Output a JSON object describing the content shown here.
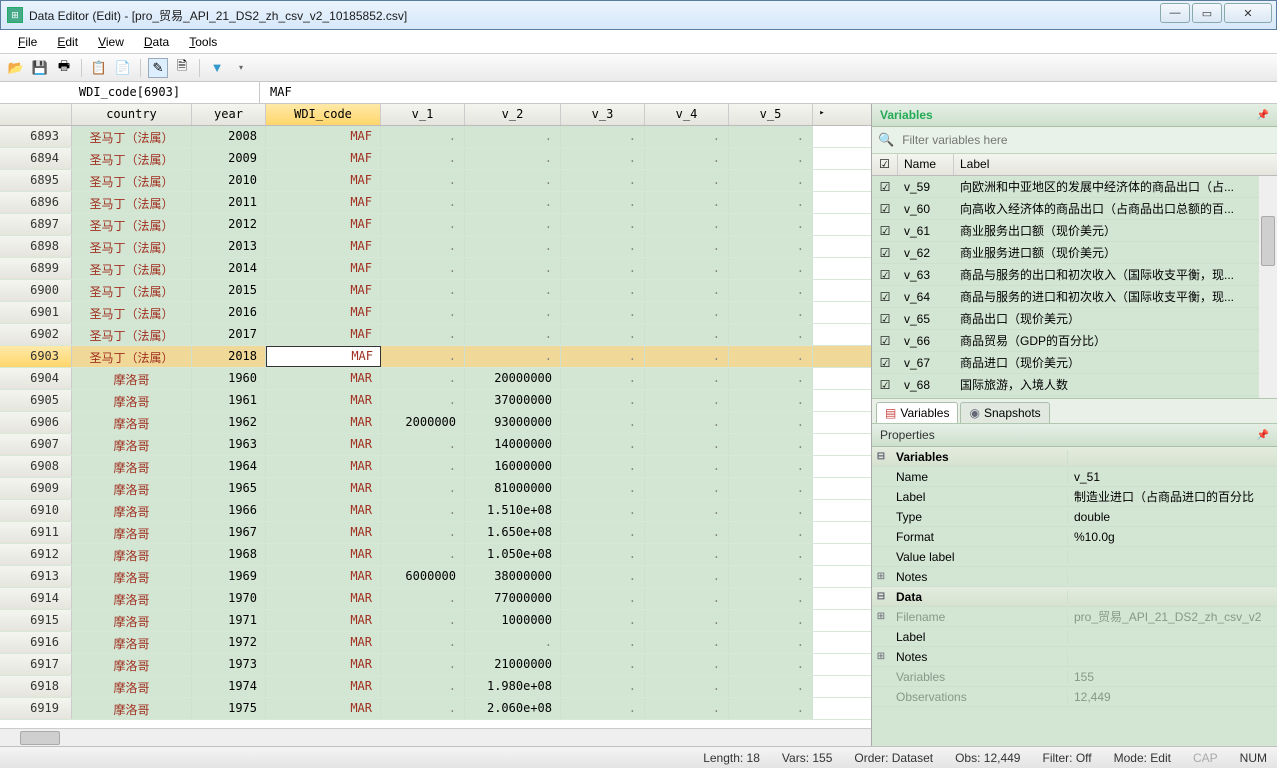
{
  "window": {
    "title": "Data Editor (Edit) - [pro_贸易_API_21_DS2_zh_csv_v2_10185852.csv]"
  },
  "menu": {
    "file": "File",
    "edit": "Edit",
    "view": "View",
    "data": "Data",
    "tools": "Tools"
  },
  "refbar": {
    "cell": "WDI_code[6903]",
    "value": "MAF"
  },
  "columns": [
    "country",
    "year",
    "WDI_code",
    "v_1",
    "v_2",
    "v_3",
    "v_4",
    "v_5"
  ],
  "selected_row": 6903,
  "rows": [
    {
      "n": 6893,
      "country": "圣马丁（法属）",
      "year": 2008,
      "code": "MAF",
      "v1": ".",
      "v2": ".",
      "v3": ".",
      "v4": ".",
      "v5": "."
    },
    {
      "n": 6894,
      "country": "圣马丁（法属）",
      "year": 2009,
      "code": "MAF",
      "v1": ".",
      "v2": ".",
      "v3": ".",
      "v4": ".",
      "v5": "."
    },
    {
      "n": 6895,
      "country": "圣马丁（法属）",
      "year": 2010,
      "code": "MAF",
      "v1": ".",
      "v2": ".",
      "v3": ".",
      "v4": ".",
      "v5": "."
    },
    {
      "n": 6896,
      "country": "圣马丁（法属）",
      "year": 2011,
      "code": "MAF",
      "v1": ".",
      "v2": ".",
      "v3": ".",
      "v4": ".",
      "v5": "."
    },
    {
      "n": 6897,
      "country": "圣马丁（法属）",
      "year": 2012,
      "code": "MAF",
      "v1": ".",
      "v2": ".",
      "v3": ".",
      "v4": ".",
      "v5": "."
    },
    {
      "n": 6898,
      "country": "圣马丁（法属）",
      "year": 2013,
      "code": "MAF",
      "v1": ".",
      "v2": ".",
      "v3": ".",
      "v4": ".",
      "v5": "."
    },
    {
      "n": 6899,
      "country": "圣马丁（法属）",
      "year": 2014,
      "code": "MAF",
      "v1": ".",
      "v2": ".",
      "v3": ".",
      "v4": ".",
      "v5": "."
    },
    {
      "n": 6900,
      "country": "圣马丁（法属）",
      "year": 2015,
      "code": "MAF",
      "v1": ".",
      "v2": ".",
      "v3": ".",
      "v4": ".",
      "v5": "."
    },
    {
      "n": 6901,
      "country": "圣马丁（法属）",
      "year": 2016,
      "code": "MAF",
      "v1": ".",
      "v2": ".",
      "v3": ".",
      "v4": ".",
      "v5": "."
    },
    {
      "n": 6902,
      "country": "圣马丁（法属）",
      "year": 2017,
      "code": "MAF",
      "v1": ".",
      "v2": ".",
      "v3": ".",
      "v4": ".",
      "v5": "."
    },
    {
      "n": 6903,
      "country": "圣马丁（法属）",
      "year": 2018,
      "code": "MAF",
      "v1": ".",
      "v2": ".",
      "v3": ".",
      "v4": ".",
      "v5": "."
    },
    {
      "n": 6904,
      "country": "摩洛哥",
      "year": 1960,
      "code": "MAR",
      "v1": ".",
      "v2": "20000000",
      "v3": ".",
      "v4": ".",
      "v5": "."
    },
    {
      "n": 6905,
      "country": "摩洛哥",
      "year": 1961,
      "code": "MAR",
      "v1": ".",
      "v2": "37000000",
      "v3": ".",
      "v4": ".",
      "v5": "."
    },
    {
      "n": 6906,
      "country": "摩洛哥",
      "year": 1962,
      "code": "MAR",
      "v1": "2000000",
      "v2": "93000000",
      "v3": ".",
      "v4": ".",
      "v5": "."
    },
    {
      "n": 6907,
      "country": "摩洛哥",
      "year": 1963,
      "code": "MAR",
      "v1": ".",
      "v2": "14000000",
      "v3": ".",
      "v4": ".",
      "v5": "."
    },
    {
      "n": 6908,
      "country": "摩洛哥",
      "year": 1964,
      "code": "MAR",
      "v1": ".",
      "v2": "16000000",
      "v3": ".",
      "v4": ".",
      "v5": "."
    },
    {
      "n": 6909,
      "country": "摩洛哥",
      "year": 1965,
      "code": "MAR",
      "v1": ".",
      "v2": "81000000",
      "v3": ".",
      "v4": ".",
      "v5": "."
    },
    {
      "n": 6910,
      "country": "摩洛哥",
      "year": 1966,
      "code": "MAR",
      "v1": ".",
      "v2": "1.510e+08",
      "v3": ".",
      "v4": ".",
      "v5": "."
    },
    {
      "n": 6911,
      "country": "摩洛哥",
      "year": 1967,
      "code": "MAR",
      "v1": ".",
      "v2": "1.650e+08",
      "v3": ".",
      "v4": ".",
      "v5": "."
    },
    {
      "n": 6912,
      "country": "摩洛哥",
      "year": 1968,
      "code": "MAR",
      "v1": ".",
      "v2": "1.050e+08",
      "v3": ".",
      "v4": ".",
      "v5": "."
    },
    {
      "n": 6913,
      "country": "摩洛哥",
      "year": 1969,
      "code": "MAR",
      "v1": "6000000",
      "v2": "38000000",
      "v3": ".",
      "v4": ".",
      "v5": "."
    },
    {
      "n": 6914,
      "country": "摩洛哥",
      "year": 1970,
      "code": "MAR",
      "v1": ".",
      "v2": "77000000",
      "v3": ".",
      "v4": ".",
      "v5": "."
    },
    {
      "n": 6915,
      "country": "摩洛哥",
      "year": 1971,
      "code": "MAR",
      "v1": ".",
      "v2": "1000000",
      "v3": ".",
      "v4": ".",
      "v5": "."
    },
    {
      "n": 6916,
      "country": "摩洛哥",
      "year": 1972,
      "code": "MAR",
      "v1": ".",
      "v2": ".",
      "v3": ".",
      "v4": ".",
      "v5": "."
    },
    {
      "n": 6917,
      "country": "摩洛哥",
      "year": 1973,
      "code": "MAR",
      "v1": ".",
      "v2": "21000000",
      "v3": ".",
      "v4": ".",
      "v5": "."
    },
    {
      "n": 6918,
      "country": "摩洛哥",
      "year": 1974,
      "code": "MAR",
      "v1": ".",
      "v2": "1.980e+08",
      "v3": ".",
      "v4": ".",
      "v5": "."
    },
    {
      "n": 6919,
      "country": "摩洛哥",
      "year": 1975,
      "code": "MAR",
      "v1": ".",
      "v2": "2.060e+08",
      "v3": ".",
      "v4": ".",
      "v5": "."
    }
  ],
  "vars_panel": {
    "title": "Variables",
    "filter_placeholder": "Filter variables here",
    "head_name": "Name",
    "head_label": "Label",
    "items": [
      {
        "name": "v_59",
        "label": "向欧洲和中亚地区的发展中经济体的商品出口（占..."
      },
      {
        "name": "v_60",
        "label": "向高收入经济体的商品出口（占商品出口总额的百..."
      },
      {
        "name": "v_61",
        "label": "商业服务出口额（现价美元）"
      },
      {
        "name": "v_62",
        "label": "商业服务进口额（现价美元）"
      },
      {
        "name": "v_63",
        "label": "商品与服务的出口和初次收入（国际收支平衡，现..."
      },
      {
        "name": "v_64",
        "label": "商品与服务的进口和初次收入（国际收支平衡，现..."
      },
      {
        "name": "v_65",
        "label": "商品出口（现价美元）"
      },
      {
        "name": "v_66",
        "label": "商品贸易（GDP的百分比）"
      },
      {
        "name": "v_67",
        "label": "商品进口（现价美元）"
      },
      {
        "name": "v_68",
        "label": "国际旅游，入境人数"
      }
    ],
    "tabs": {
      "vars": "Variables",
      "snaps": "Snapshots"
    }
  },
  "props_panel": {
    "title": "Properties",
    "sec_vars": "Variables",
    "name_k": "Name",
    "name_v": "v_51",
    "label_k": "Label",
    "label_v": "制造业进口（占商品进口的百分比",
    "type_k": "Type",
    "type_v": "double",
    "format_k": "Format",
    "format_v": "%10.0g",
    "vlabel_k": "Value label",
    "vlabel_v": "",
    "notes_k": "Notes",
    "sec_data": "Data",
    "fname_k": "Filename",
    "fname_v": "pro_贸易_API_21_DS2_zh_csv_v2",
    "dlabel_k": "Label",
    "dlabel_v": "",
    "dnotes_k": "Notes",
    "vars_k": "Variables",
    "vars_v": "155",
    "obs_k": "Observations",
    "obs_v": "12,449"
  },
  "status": {
    "length": "Length: 18",
    "vars": "Vars: 155",
    "order": "Order: Dataset",
    "obs": "Obs: 12,449",
    "filter": "Filter: Off",
    "mode": "Mode: Edit",
    "cap": "CAP",
    "num": "NUM"
  }
}
